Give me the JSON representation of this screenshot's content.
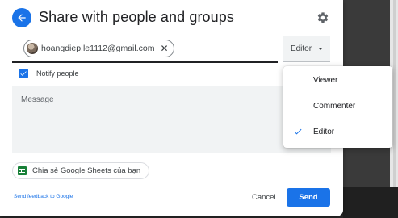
{
  "dialog": {
    "title": "Share with people and groups",
    "recipient_email": "hoangdiep.le1112@gmail.com",
    "role_selected": "Editor",
    "notify_label": "Notify people",
    "notify_checked": true,
    "message_placeholder": "Message",
    "sheets_chip_label": "Chia sẻ Google Sheets của bạn",
    "feedback_link": "Send feedback to Google",
    "cancel_label": "Cancel",
    "send_label": "Send"
  },
  "role_menu": {
    "items": [
      {
        "label": "Viewer",
        "checked": false
      },
      {
        "label": "Commenter",
        "checked": false
      },
      {
        "label": "Editor",
        "checked": true
      }
    ]
  },
  "colors": {
    "accent": "#1a73e8",
    "sheets_green": "#188038",
    "text": "#202124",
    "field_bg": "#f1f3f4"
  },
  "icons": [
    "back-arrow-icon",
    "gear-icon",
    "close-icon",
    "caret-down-icon",
    "checkmark-icon",
    "sheets-icon"
  ]
}
